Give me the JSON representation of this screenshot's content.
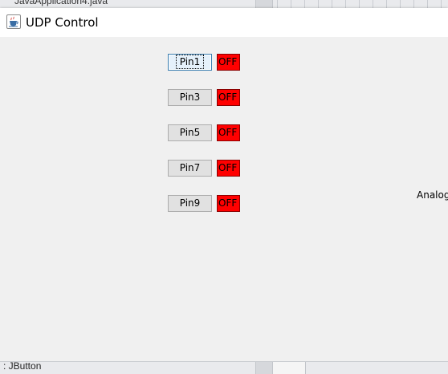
{
  "background_ide": {
    "file_tab": "JavaApplication4.java",
    "status_bar_label": ": JButton"
  },
  "window": {
    "title": "UDP Control",
    "icon": "java-coffee-cup-icon"
  },
  "pins": [
    {
      "label": "Pin1",
      "status": "OFF",
      "focused": true
    },
    {
      "label": "Pin3",
      "status": "OFF",
      "focused": false
    },
    {
      "label": "Pin5",
      "status": "OFF",
      "focused": false
    },
    {
      "label": "Pin7",
      "status": "OFF",
      "focused": false
    },
    {
      "label": "Pin9",
      "status": "OFF",
      "focused": false
    }
  ],
  "analog_label": "Analog",
  "colors": {
    "status_off": "#ff0000",
    "button_face": "#e1e1e1",
    "focus_border": "#3c7fb1",
    "window_bg": "#f0f0f0",
    "titlebar_bg": "#ffffff"
  }
}
